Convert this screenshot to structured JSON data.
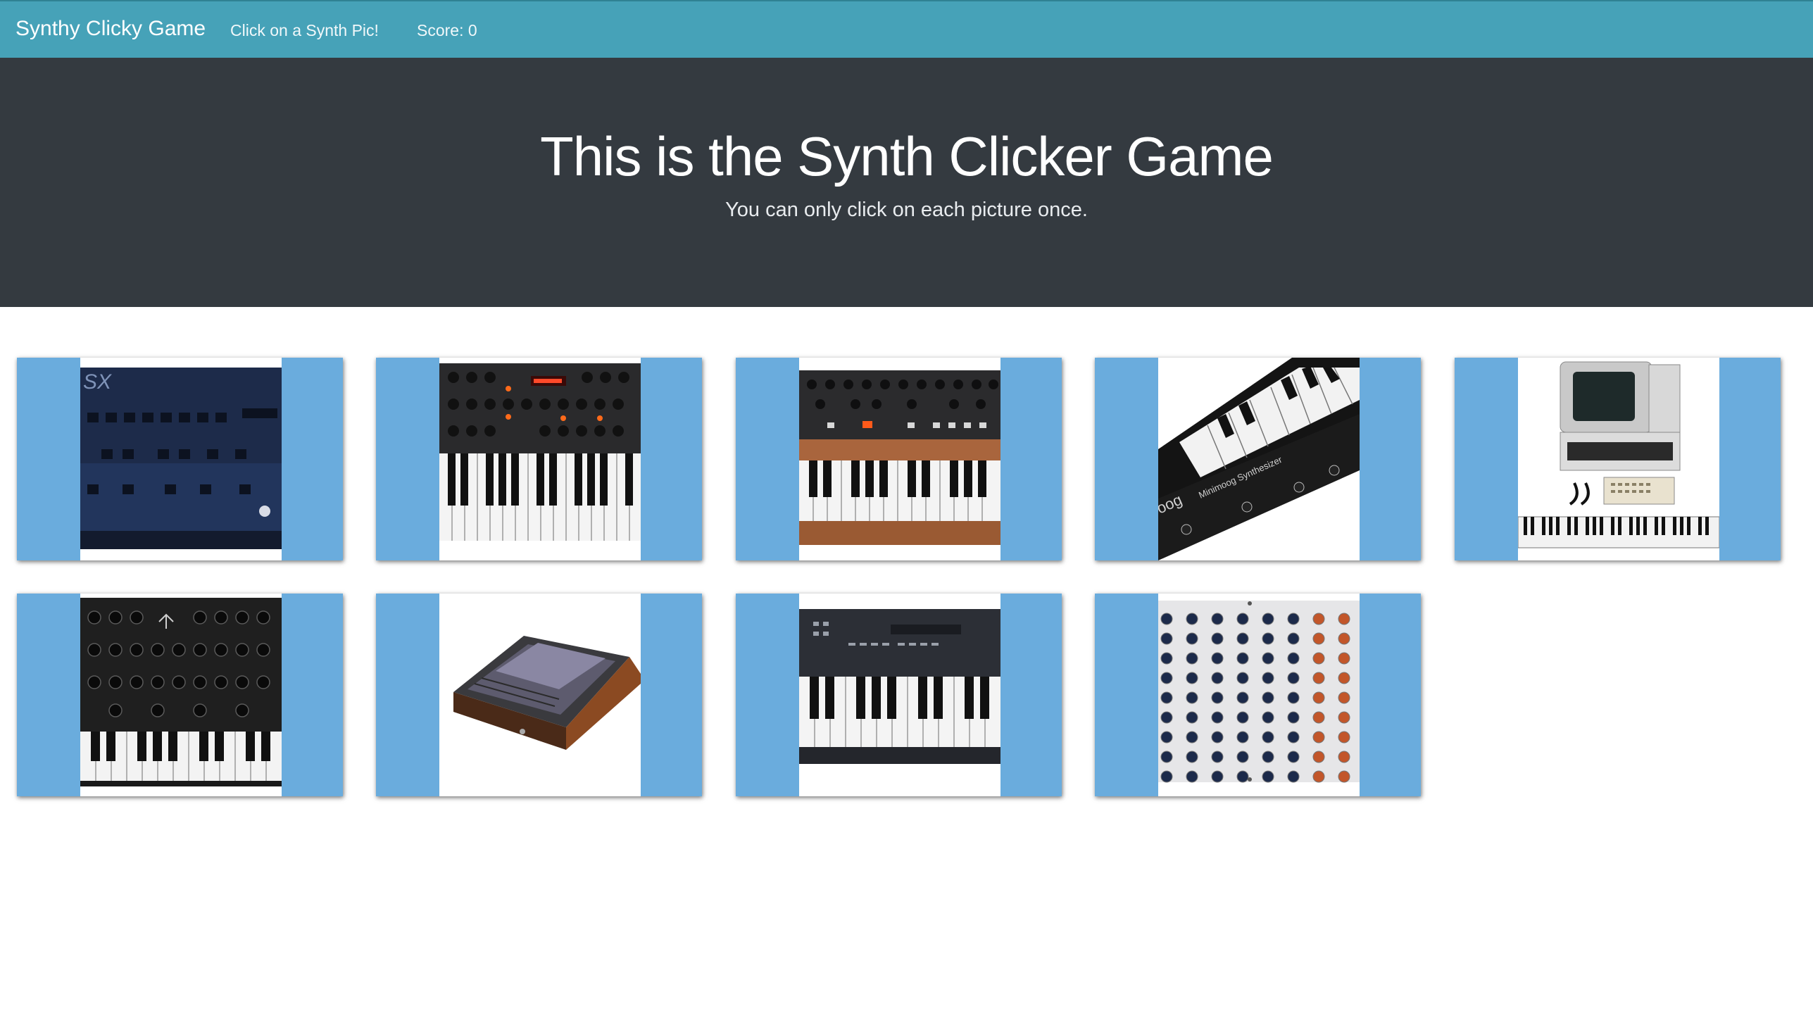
{
  "navbar": {
    "brand": "Synthy Clicky Game",
    "instruction": "Click on a Synth Pic!",
    "score_text": "Score: 0"
  },
  "jumbotron": {
    "title": "This is the Synth Clicker Game",
    "subtitle": "You can only click on each picture once."
  },
  "synth_pictures": [
    {
      "alt": "blue analog synth panel"
    },
    {
      "alt": "black synth with keyboard and display"
    },
    {
      "alt": "synth with wooden base and keyboard"
    },
    {
      "alt": "minimoog style synthesizer",
      "logo_text": "Minimoog Synthesizer"
    },
    {
      "alt": "vintage computer with monitor and keyboard"
    },
    {
      "alt": "analog synth with knobs and keyboard"
    },
    {
      "alt": "wooden cased sequencer"
    },
    {
      "alt": "digital workstation keyboard"
    },
    {
      "alt": "modular knob panel"
    }
  ],
  "colors": {
    "navbar_bg": "#46a2b8",
    "jumbotron_bg": "#343a40",
    "card_bg": "#6aacdd"
  }
}
